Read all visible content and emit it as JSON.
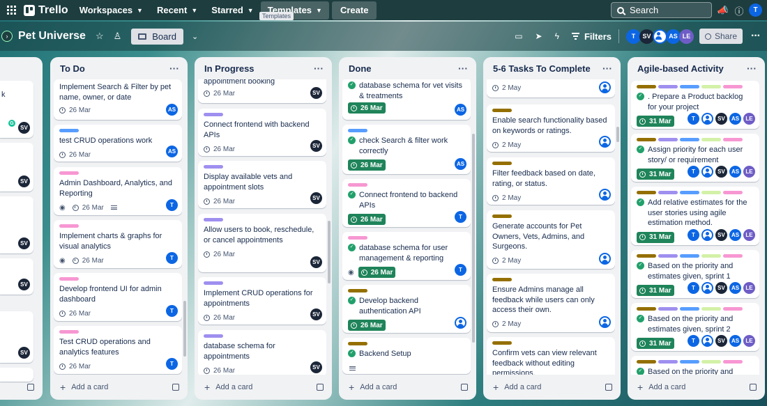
{
  "topbar": {
    "brand": "Trello",
    "nav": [
      {
        "label": "Workspaces"
      },
      {
        "label": "Recent"
      },
      {
        "label": "Starred"
      },
      {
        "label": "Templates"
      }
    ],
    "create_label": "Create",
    "tooltip": "Templates",
    "search_placeholder": "Search",
    "user_initial": "T"
  },
  "board": {
    "title": "Pet Universe",
    "view_label": "Board",
    "filters_label": "Filters",
    "share_label": "Share",
    "members": [
      {
        "initials": "T",
        "color": "#0c66e4"
      },
      {
        "initials": "SV",
        "color": "#1b2638"
      },
      {
        "initials": "",
        "color": "#0c66e4"
      },
      {
        "initials": "AS",
        "color": "#0c66e4"
      },
      {
        "initials": "LE",
        "color": "#6e5dc6"
      }
    ]
  },
  "partial_list": {
    "visible_text": [
      "k"
    ],
    "members": [
      "SV",
      "SV",
      "SV",
      "SV",
      "SV"
    ]
  },
  "lists": [
    {
      "name": "To Do",
      "add_label": "Add a card",
      "cards": [
        {
          "title": "Implement Search & Filter by pet name, owner, or date",
          "date": "26 Mar",
          "members": [
            "AS"
          ]
        },
        {
          "title": "test CRUD operations work",
          "date": "26 Mar",
          "members": [
            "AS"
          ]
        },
        {
          "title": "Admin Dashboard, Analytics, and Reporting",
          "date": "26 Mar",
          "members": [
            "T"
          ]
        },
        {
          "title": "Implement charts & graphs for visual analytics",
          "date": "26 Mar",
          "members": [
            "T"
          ]
        },
        {
          "title": "Develop frontend UI for admin dashboard",
          "date": "26 Mar",
          "members": [
            "T"
          ]
        },
        {
          "title": "Test CRUD operations and analytics features",
          "date": "26 Mar",
          "members": [
            "T"
          ]
        }
      ]
    },
    {
      "name": "In Progress",
      "add_label": "Add a card",
      "cards": [
        {
          "title": "appointment booking",
          "date": "26 Mar",
          "members": [
            "SV"
          ]
        },
        {
          "title": "Connect frontend with backend APIs",
          "date": "26 Mar",
          "members": [
            "SV"
          ]
        },
        {
          "title": "Display available vets and appointment slots",
          "date": "26 Mar",
          "members": [
            "SV"
          ]
        },
        {
          "title": "Allow users to book, reschedule, or cancel appointments",
          "date": "26 Mar",
          "members": [
            "SV"
          ]
        },
        {
          "title": "Implement CRUD operations for appointments",
          "date": "26 Mar",
          "members": [
            "SV"
          ]
        },
        {
          "title": "database schema for appointments",
          "date": "26 Mar",
          "members": [
            "SV"
          ]
        }
      ]
    },
    {
      "name": "Done",
      "add_label": "Add a card",
      "cards": [
        {
          "title": "database schema for vet visits & treatments",
          "date": "26 Mar",
          "members": [
            "AS"
          ]
        },
        {
          "title": "check Search & filter work correctly",
          "date": "26 Mar",
          "members": [
            "AS"
          ]
        },
        {
          "title": "Connect frontend to backend APIs",
          "date": "26 Mar",
          "members": [
            "T"
          ]
        },
        {
          "title": "database schema for user management & reporting",
          "date": "26 Mar",
          "members": [
            "T"
          ]
        },
        {
          "title": "Develop backend authentication API",
          "date": "26 Mar",
          "members": [
            "user"
          ]
        },
        {
          "title": "Backend Setup",
          "date": "",
          "members": []
        }
      ]
    },
    {
      "name": "5-6 Tasks To Complete",
      "add_label": "Add a card",
      "cards": [
        {
          "title": "",
          "date": "2 May",
          "members": [
            "user"
          ]
        },
        {
          "title": "Enable search functionality based on keywords or ratings.",
          "date": "2 May",
          "members": [
            "user"
          ]
        },
        {
          "title": "Filter feedback based on date, rating, or status.",
          "date": "2 May",
          "members": [
            "user"
          ]
        },
        {
          "title": "Generate accounts for Pet Owners, Vets, Admins, and Surgeons.",
          "date": "2 May",
          "members": [
            "user"
          ]
        },
        {
          "title": "Ensure Admins manage all feedback while users can only access their own.",
          "date": "2 May",
          "members": [
            "user"
          ]
        },
        {
          "title": "Confirm vets can view relevant feedback without editing permissions.",
          "date": "",
          "members": []
        }
      ]
    },
    {
      "name": "Agile-based Activity",
      "add_label": "Add a card",
      "cards": [
        {
          "title": ". Prepare a Product backlog for your project",
          "date": "31 Mar",
          "members": [
            "T",
            "user",
            "SV",
            "AS",
            "LE"
          ]
        },
        {
          "title": "Assign priority for each user story/ or requirement",
          "date": "31 Mar",
          "members": [
            "T",
            "user",
            "SV",
            "AS",
            "LE"
          ]
        },
        {
          "title": "Add relative estimates for the user stories using agile estimation method.",
          "date": "31 Mar",
          "members": [
            "T",
            "user",
            "SV",
            "AS",
            "LE"
          ]
        },
        {
          "title": "Based on the priority and estimates given, sprint 1",
          "date": "31 Mar",
          "members": [
            "T",
            "user",
            "SV",
            "AS",
            "LE"
          ]
        },
        {
          "title": "Based on the priority and estimates given, sprint 2",
          "date": "31 Mar",
          "members": [
            "T",
            "user",
            "SV",
            "AS",
            "LE"
          ]
        },
        {
          "title": "Based on the priority and",
          "date": "",
          "members": []
        }
      ]
    }
  ],
  "label_colors": {
    "blue": "#579dff",
    "pink": "#f797d2",
    "purple": "#9f8fef",
    "olive": "#946f00",
    "green": "#baf3db",
    "lime": "#d3f1a7"
  }
}
